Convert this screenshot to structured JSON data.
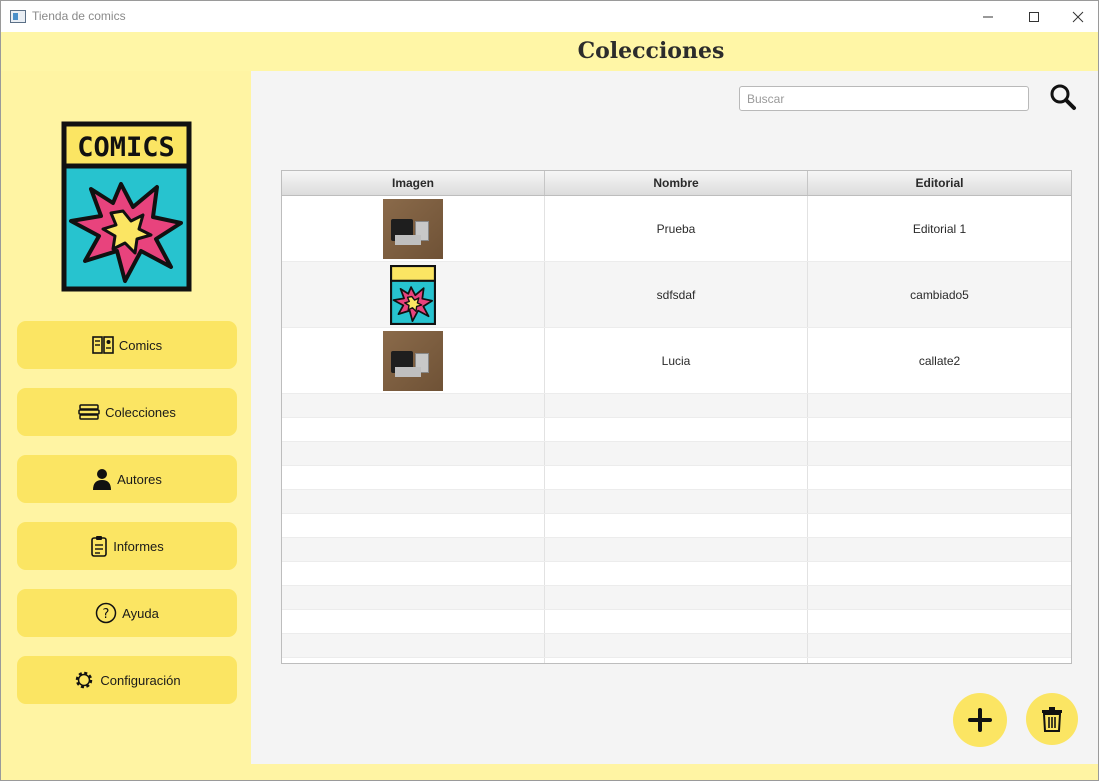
{
  "window": {
    "title": "Tienda de comics"
  },
  "header": {
    "title": "Colecciones"
  },
  "logo": {
    "text": "COMICS"
  },
  "sidebar": {
    "items": [
      {
        "label": "Comics",
        "icon": "book-icon"
      },
      {
        "label": "Colecciones",
        "icon": "stack-icon"
      },
      {
        "label": "Autores",
        "icon": "person-icon"
      },
      {
        "label": "Informes",
        "icon": "clipboard-icon"
      },
      {
        "label": "Ayuda",
        "icon": "help-icon"
      },
      {
        "label": "Configuración",
        "icon": "gear-icon"
      }
    ]
  },
  "search": {
    "placeholder": "Buscar",
    "value": ""
  },
  "table": {
    "columns": [
      "Imagen",
      "Nombre",
      "Editorial"
    ],
    "rows": [
      {
        "image": "photo",
        "nombre": "Prueba",
        "editorial": "Editorial 1"
      },
      {
        "image": "comics-logo",
        "nombre": "sdfsdaf",
        "editorial": "cambiado5"
      },
      {
        "image": "photo",
        "nombre": "Lucia",
        "editorial": "callate2"
      }
    ]
  },
  "colors": {
    "accent": "#fbe563",
    "sidebar": "#fff4a3",
    "content": "#f4f4f4"
  }
}
